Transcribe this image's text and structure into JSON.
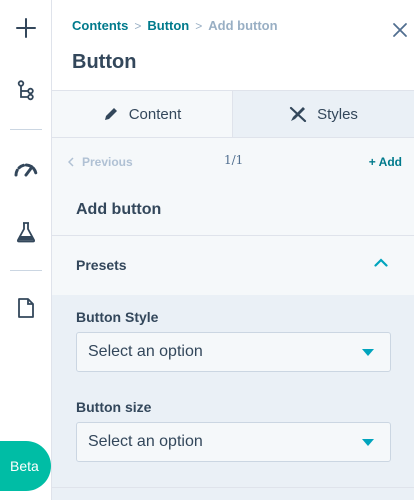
{
  "breadcrumb": {
    "items": [
      "Contents",
      "Button"
    ],
    "current": "Add button",
    "separator": ">"
  },
  "header": {
    "title": "Button"
  },
  "tabs": {
    "content": "Content",
    "styles": "Styles"
  },
  "pager": {
    "previous": "Previous",
    "count": "1/1",
    "add": "+ Add"
  },
  "section": {
    "title": "Add button"
  },
  "presets": {
    "label": "Presets"
  },
  "fields": {
    "style_label": "Button Style",
    "style_value": "Select an option",
    "size_label": "Button size",
    "size_value": "Select an option"
  },
  "beta": {
    "label": "Beta"
  },
  "icons": {
    "rail": [
      "plus-icon",
      "tree-icon",
      "gauge-icon",
      "flask-icon",
      "document-icon"
    ],
    "close": "close-icon"
  },
  "colors": {
    "accent": "#007a8c",
    "beta": "#00bda5",
    "caret": "#00a4bd",
    "text": "#33475b"
  }
}
